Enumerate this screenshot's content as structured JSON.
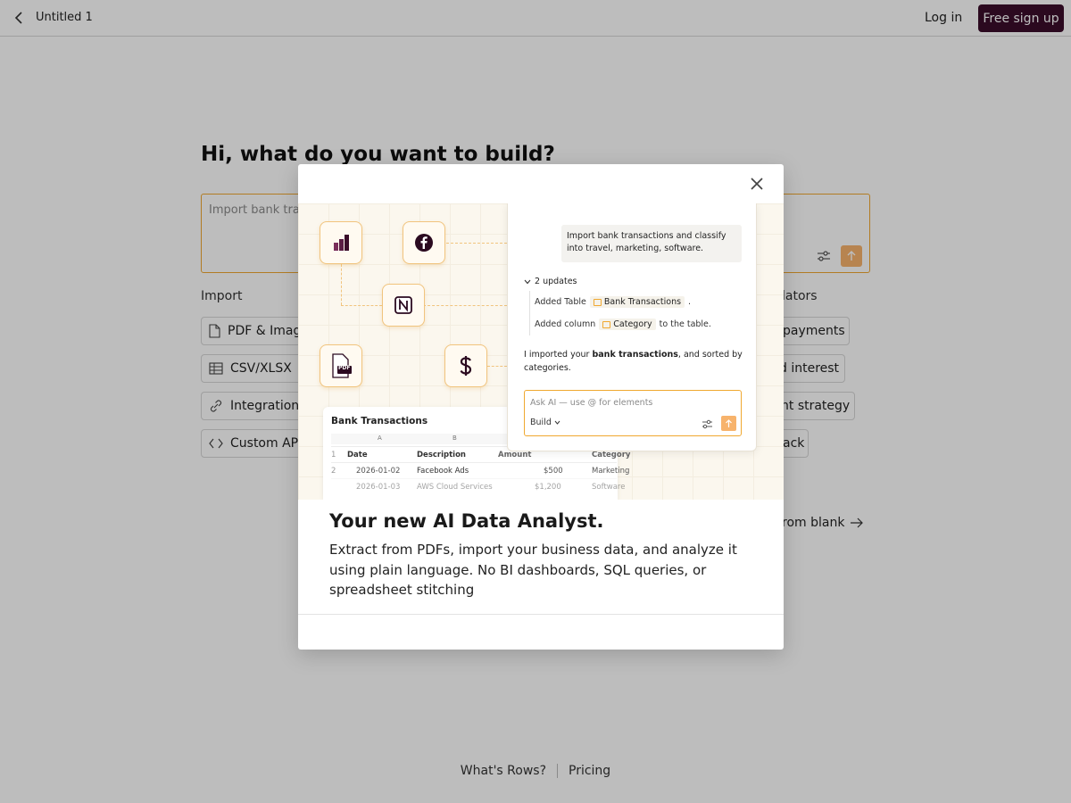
{
  "header": {
    "doc_title": "Untitled 1",
    "login_label": "Log in",
    "signup_label": "Free sign up"
  },
  "hero": {
    "title": "Hi, what do you want to build?",
    "prompt_placeholder": "Import bank tra"
  },
  "import_section": {
    "label": "Import",
    "items": [
      {
        "label": "PDF & Imag",
        "icon": "file-icon"
      },
      {
        "label": "CSV/XLSX",
        "icon": "table-icon"
      },
      {
        "label": "Integration",
        "icon": "link-icon"
      },
      {
        "label": "Custom API",
        "icon": "code-icon"
      }
    ]
  },
  "calculators_section": {
    "label": "lators",
    "items": [
      {
        "label": "payments"
      },
      {
        "label": "d interest"
      },
      {
        "label": "nt strategy"
      },
      {
        "label": "ack"
      }
    ]
  },
  "start_blank_label": "rom blank",
  "footer": {
    "whats_rows": "What's Rows?",
    "pricing": "Pricing"
  },
  "modal": {
    "heading": "Your new AI Data Analyst.",
    "description": "Extract from PDFs, import your business data, and analyze it using plain language. No BI dashboards, SQL queries, or spreadsheet stitching",
    "illustration": {
      "tiles": [
        "powerbi-icon",
        "facebook-icon",
        "notion-icon",
        "pdf-icon",
        "dollar-icon"
      ],
      "pdf_badge": "PDF",
      "table": {
        "title": "Bank Transactions",
        "col_letters": [
          "A",
          "B"
        ],
        "headers": [
          "Date",
          "Description",
          "Amount",
          "Category"
        ],
        "rows": [
          {
            "num": "2",
            "date": "2026-01-02",
            "desc": "Facebook Ads",
            "amount": "$500",
            "category": "Marketing"
          },
          {
            "num": "",
            "date": "2026-01-03",
            "desc": "AWS Cloud Services",
            "amount": "$1,200",
            "category": "Software"
          }
        ]
      },
      "chat": {
        "user_message": "Import bank transactions and classify into travel, marketing, software.",
        "updates_label": "2 updates",
        "update_1_prefix": "Added Table",
        "update_1_pill": "Bank Transactions",
        "update_1_suffix": ".",
        "update_2_prefix": "Added column",
        "update_2_pill": "Category",
        "update_2_suffix": "to the table.",
        "reply_prefix": "I imported your ",
        "reply_bold": "bank transactions",
        "reply_suffix": ", and sorted by categories.",
        "ask_placeholder": "Ask AI — use @ for elements",
        "build_label": "Build"
      }
    }
  },
  "colors": {
    "brand_dark": "#3a0d2a",
    "accent_orange": "#f0a830",
    "send_orange": "#f7b36c"
  }
}
